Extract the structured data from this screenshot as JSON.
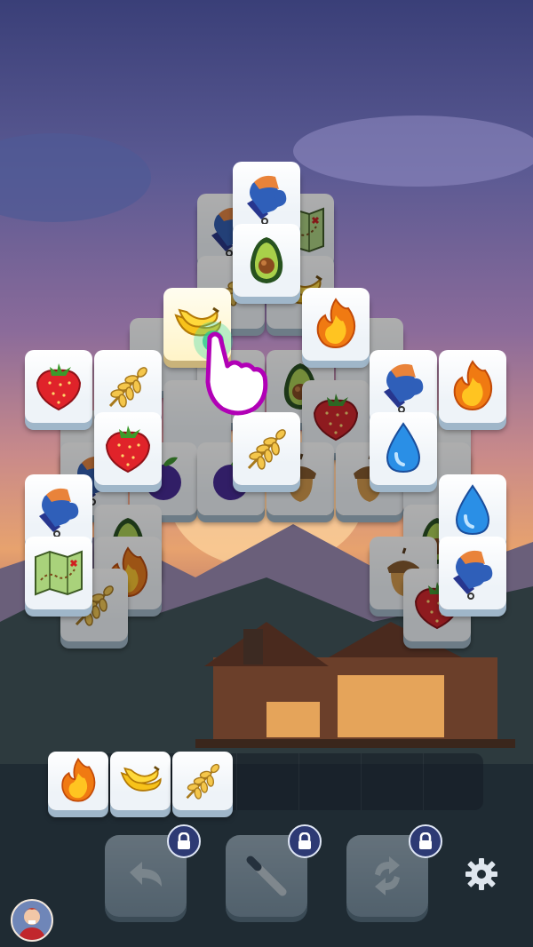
{
  "game": {
    "board_tiles": [
      {
        "icon": "mitten-icon",
        "state": "top"
      },
      {
        "icon": "avocado-icon",
        "state": "top"
      },
      {
        "icon": "banana-icon",
        "state": "selected"
      },
      {
        "icon": "fire-icon",
        "state": "top"
      },
      {
        "icon": "strawberry-icon",
        "state": "top"
      },
      {
        "icon": "wheat-icon",
        "state": "top"
      },
      {
        "icon": "mitten-icon",
        "state": "top"
      },
      {
        "icon": "fire-icon",
        "state": "top"
      },
      {
        "icon": "strawberry-icon",
        "state": "top"
      },
      {
        "icon": "wheat-icon",
        "state": "top"
      },
      {
        "icon": "water-drop-icon",
        "state": "top"
      },
      {
        "icon": "mitten-icon",
        "state": "top"
      },
      {
        "icon": "water-drop-icon",
        "state": "top"
      },
      {
        "icon": "map-icon",
        "state": "top"
      },
      {
        "icon": "mitten-icon",
        "state": "top"
      }
    ],
    "tray": {
      "slot_count": 7,
      "tiles": [
        {
          "icon": "fire-icon"
        },
        {
          "icon": "banana-icon"
        },
        {
          "icon": "wheat-icon"
        }
      ]
    },
    "tools": [
      {
        "name": "undo",
        "icon": "undo-icon",
        "locked": true
      },
      {
        "name": "magic-wand",
        "icon": "wand-icon",
        "locked": true
      },
      {
        "name": "shuffle",
        "icon": "shuffle-icon",
        "locked": true
      }
    ],
    "settings_icon": "gear-icon",
    "avatar_icon": "avatar-icon",
    "colors": {
      "tile_face": "#ffffff",
      "tile_side": "#9fb6c9",
      "lock_badge": "#2d3a74",
      "tutorial_hand": "#b100b6"
    }
  }
}
